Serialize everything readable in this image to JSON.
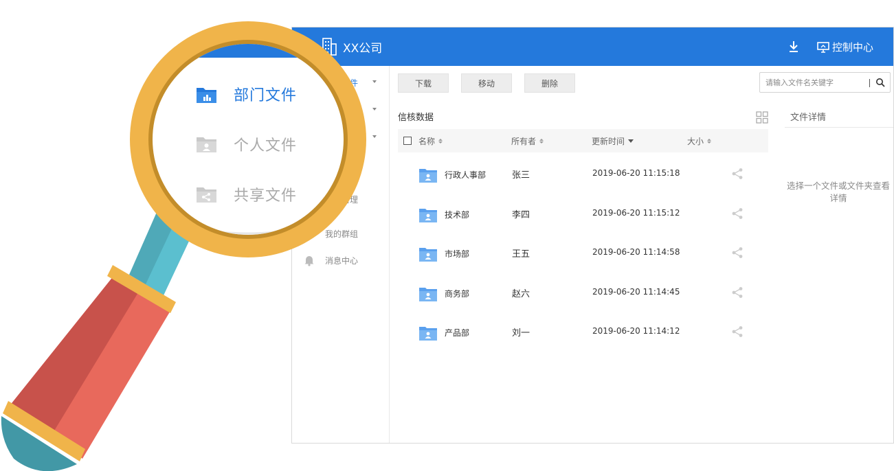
{
  "header": {
    "company_name": "XX公司",
    "control_center_label": "控制中心"
  },
  "sidebar": {
    "frag_files": "件",
    "frag_manage": "管理",
    "my_groups": "我的群组",
    "messages": "消息中心"
  },
  "toolbar": {
    "download_label": "下载",
    "move_label": "移动",
    "delete_label": "删除"
  },
  "search": {
    "placeholder": "请输入文件名关键字"
  },
  "main": {
    "breadcrumb": "信核数据"
  },
  "table": {
    "columns": [
      "名称",
      "所有者",
      "更新时间",
      "大小"
    ],
    "rows": [
      {
        "name": "行政人事部",
        "owner": "张三",
        "updated": "2019-06-20 11:15:18"
      },
      {
        "name": "技术部",
        "owner": "李四",
        "updated": "2019-06-20 11:15:12"
      },
      {
        "name": "市场部",
        "owner": "王五",
        "updated": "2019-06-20 11:14:58"
      },
      {
        "name": "商务部",
        "owner": "赵六",
        "updated": "2019-06-20 11:14:45"
      },
      {
        "name": "产品部",
        "owner": "刘一",
        "updated": "2019-06-20 11:14:12"
      }
    ]
  },
  "detail": {
    "title": "文件详情",
    "empty_text": "选择一个文件或文件夹查看详情"
  },
  "magnifier": {
    "items": [
      {
        "label": "部门文件",
        "icon": "department-folder-icon",
        "active": true
      },
      {
        "label": "个人文件",
        "icon": "personal-folder-icon",
        "active": false
      },
      {
        "label": "共享文件",
        "icon": "shared-folder-icon",
        "active": false
      }
    ]
  },
  "colors": {
    "accent": "#2479dc",
    "lens_ring": "#f0b44a",
    "handle_red": "#e8695c",
    "handle_teal": "#4fa9b8"
  }
}
